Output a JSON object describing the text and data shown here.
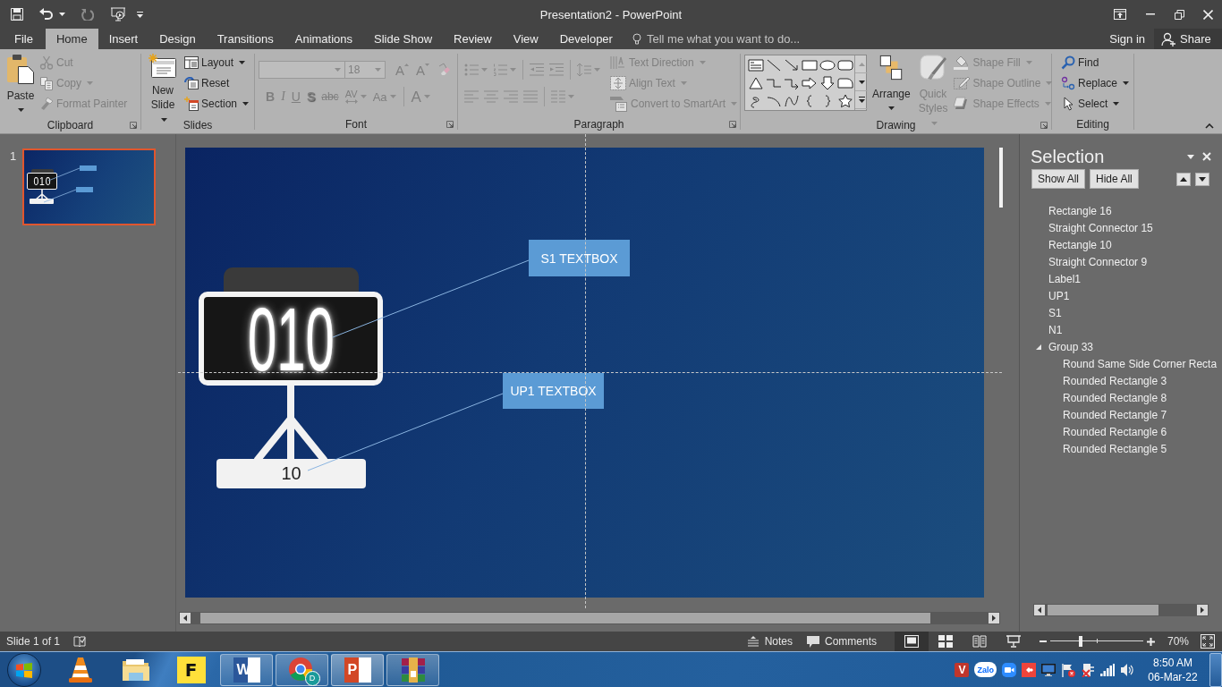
{
  "window": {
    "title": "Presentation2 - PowerPoint"
  },
  "tabs": [
    {
      "label": "File",
      "selected": false
    },
    {
      "label": "Home",
      "selected": true
    },
    {
      "label": "Insert",
      "selected": false
    },
    {
      "label": "Design",
      "selected": false
    },
    {
      "label": "Transitions",
      "selected": false
    },
    {
      "label": "Animations",
      "selected": false
    },
    {
      "label": "Slide Show",
      "selected": false
    },
    {
      "label": "Review",
      "selected": false
    },
    {
      "label": "View",
      "selected": false
    },
    {
      "label": "Developer",
      "selected": false
    }
  ],
  "tell_me": {
    "placeholder": "Tell me what you want to do..."
  },
  "account": {
    "sign_in": "Sign in",
    "share": "Share"
  },
  "ribbon": {
    "groups": [
      {
        "kind": "clipboard",
        "label": "Clipboard",
        "launcher": true,
        "items": [
          {
            "kind": "paste",
            "label": "Paste",
            "menu": true,
            "disabled": false
          },
          {
            "kind": "cut",
            "label": "Cut",
            "menu": false,
            "disabled": true
          },
          {
            "kind": "copy",
            "label": "Copy",
            "menu": true,
            "disabled": true
          },
          {
            "kind": "format_painter",
            "label": "Format Painter",
            "menu": false,
            "disabled": true
          }
        ]
      },
      {
        "kind": "slides",
        "label": "Slides",
        "launcher": false,
        "items": [
          {
            "kind": "new_slide",
            "label": "New Slide",
            "menu": true,
            "disabled": false
          },
          {
            "kind": "layout",
            "label": "Layout",
            "menu": true,
            "disabled": false
          },
          {
            "kind": "reset",
            "label": "Reset",
            "menu": false,
            "disabled": false
          },
          {
            "kind": "section",
            "label": "Section",
            "menu": true,
            "disabled": false
          }
        ]
      },
      {
        "kind": "font",
        "label": "Font",
        "launcher": true,
        "items": [
          {
            "kind": "font_name",
            "menu": true,
            "disabled": true
          },
          {
            "kind": "font_size",
            "value": "18",
            "menu": true,
            "disabled": true
          },
          {
            "kind": "grow_font",
            "label": "A",
            "menu": false,
            "disabled": true
          },
          {
            "kind": "shrink_font",
            "label": "A",
            "menu": false,
            "disabled": true
          },
          {
            "kind": "clear_formatting",
            "menu": false,
            "disabled": true
          },
          {
            "kind": "bold",
            "label": "B",
            "menu": false,
            "disabled": true
          },
          {
            "kind": "italic",
            "label": "I",
            "menu": false,
            "disabled": true
          },
          {
            "kind": "underline",
            "label": "U",
            "menu": false,
            "disabled": true
          },
          {
            "kind": "text_shadow",
            "label": "S",
            "menu": false,
            "disabled": true
          },
          {
            "kind": "strikethrough",
            "label": "abc",
            "menu": false,
            "disabled": true
          },
          {
            "kind": "character_spacing",
            "label": "AV",
            "menu": true,
            "disabled": true
          },
          {
            "kind": "change_case",
            "label": "Aa",
            "menu": true,
            "disabled": true
          },
          {
            "kind": "font_color",
            "label": "A",
            "menu": true,
            "disabled": true
          }
        ]
      },
      {
        "kind": "paragraph",
        "label": "Paragraph",
        "launcher": true,
        "items": [
          {
            "kind": "bullets",
            "menu": true,
            "disabled": true
          },
          {
            "kind": "numbering",
            "menu": true,
            "disabled": true
          },
          {
            "kind": "decrease_indent",
            "menu": false,
            "disabled": true
          },
          {
            "kind": "increase_indent",
            "menu": false,
            "disabled": true
          },
          {
            "kind": "line_spacing",
            "menu": true,
            "disabled": true
          },
          {
            "kind": "align_left",
            "menu": false,
            "disabled": true
          },
          {
            "kind": "center",
            "menu": false,
            "disabled": true
          },
          {
            "kind": "align_right",
            "menu": false,
            "disabled": true
          },
          {
            "kind": "justify",
            "menu": false,
            "disabled": true
          },
          {
            "kind": "columns",
            "menu": true,
            "disabled": true
          },
          {
            "kind": "text_direction",
            "label": "Text Direction",
            "menu": true,
            "disabled": true
          },
          {
            "kind": "align_text",
            "label": "Align Text",
            "menu": true,
            "disabled": true
          },
          {
            "kind": "smartart",
            "label": "Convert to SmartArt",
            "menu": true,
            "disabled": true
          }
        ]
      },
      {
        "kind": "drawing",
        "label": "Drawing",
        "launcher": true,
        "items": [
          {
            "kind": "shapes",
            "menu": true,
            "disabled": false
          },
          {
            "kind": "arrange",
            "label": "Arrange",
            "menu": true,
            "disabled": false
          },
          {
            "kind": "quick_styles",
            "label": "Quick Styles",
            "menu": true,
            "disabled": true
          },
          {
            "kind": "shape_fill",
            "label": "Shape Fill",
            "menu": true,
            "disabled": true
          },
          {
            "kind": "shape_outline",
            "label": "Shape Outline",
            "menu": true,
            "disabled": true
          },
          {
            "kind": "shape_effects",
            "label": "Shape Effects",
            "menu": true,
            "disabled": true
          }
        ]
      },
      {
        "kind": "editing",
        "label": "Editing",
        "launcher": false,
        "items": [
          {
            "kind": "find",
            "label": "Find",
            "menu": false,
            "disabled": false
          },
          {
            "kind": "replace",
            "label": "Replace",
            "menu": true,
            "disabled": false
          },
          {
            "kind": "select",
            "label": "Select",
            "menu": true,
            "disabled": false
          }
        ]
      }
    ]
  },
  "thumbnails": [
    {
      "number": "1",
      "selected": true,
      "display": "010"
    }
  ],
  "slide": {
    "display": {
      "reading": "010",
      "base_label": "10"
    },
    "textboxes": [
      {
        "label": "S1 TEXTBOX"
      },
      {
        "label": "UP1 TEXTBOX"
      }
    ]
  },
  "selection_pane": {
    "title": "Selection",
    "buttons": [
      {
        "label": "Show All"
      },
      {
        "label": "Hide All"
      }
    ],
    "items": [
      {
        "label": "Rectangle 16"
      },
      {
        "label": "Straight Connector 15"
      },
      {
        "label": "Rectangle 10"
      },
      {
        "label": "Straight Connector 9"
      },
      {
        "label": "Label1"
      },
      {
        "label": "UP1"
      },
      {
        "label": "S1"
      },
      {
        "label": "N1"
      },
      {
        "label": "Group 33",
        "expanded": true,
        "children": [
          {
            "label": "Round Same Side Corner Recta"
          },
          {
            "label": "Rounded Rectangle 3"
          },
          {
            "label": "Rounded Rectangle 8"
          },
          {
            "label": "Rounded Rectangle 7"
          },
          {
            "label": "Rounded Rectangle 6"
          },
          {
            "label": "Rounded Rectangle 5"
          }
        ]
      }
    ]
  },
  "status_bar": {
    "slide_info": "Slide 1 of 1",
    "notes": "Notes",
    "comments": "Comments",
    "views": [
      {
        "kind": "normal",
        "selected": true
      },
      {
        "kind": "slide_sorter",
        "selected": false
      },
      {
        "kind": "reading",
        "selected": false
      },
      {
        "kind": "slide_show",
        "selected": false
      }
    ],
    "zoom": {
      "level": 0.33,
      "reading": "70%"
    }
  },
  "taskbar": {
    "apps": [
      {
        "kind": "cone",
        "running": false,
        "selected": false
      },
      {
        "kind": "folder",
        "running": false,
        "selected": false
      },
      {
        "kind": "letter_tile",
        "glyph": "F",
        "running": false,
        "selected": false
      },
      {
        "kind": "document",
        "glyph": "W",
        "running": true,
        "selected": false
      },
      {
        "kind": "browser",
        "glyph": "D",
        "running": true,
        "selected": false
      },
      {
        "kind": "slides_doc",
        "glyph": "P",
        "running": true,
        "selected": true
      },
      {
        "kind": "books",
        "running": true,
        "selected": false
      }
    ],
    "tray": [
      {
        "kind": "letter_tile",
        "glyph": "V"
      },
      {
        "kind": "chat_bubble",
        "glyph": "Zalo"
      },
      {
        "kind": "camera"
      },
      {
        "kind": "diamond_tile"
      },
      {
        "kind": "monitor"
      },
      {
        "kind": "flag_error"
      },
      {
        "kind": "plug_error"
      },
      {
        "kind": "signal"
      },
      {
        "kind": "speaker"
      }
    ],
    "clock": {
      "time": "8:50 AM",
      "date": "06-Mar-22"
    }
  }
}
